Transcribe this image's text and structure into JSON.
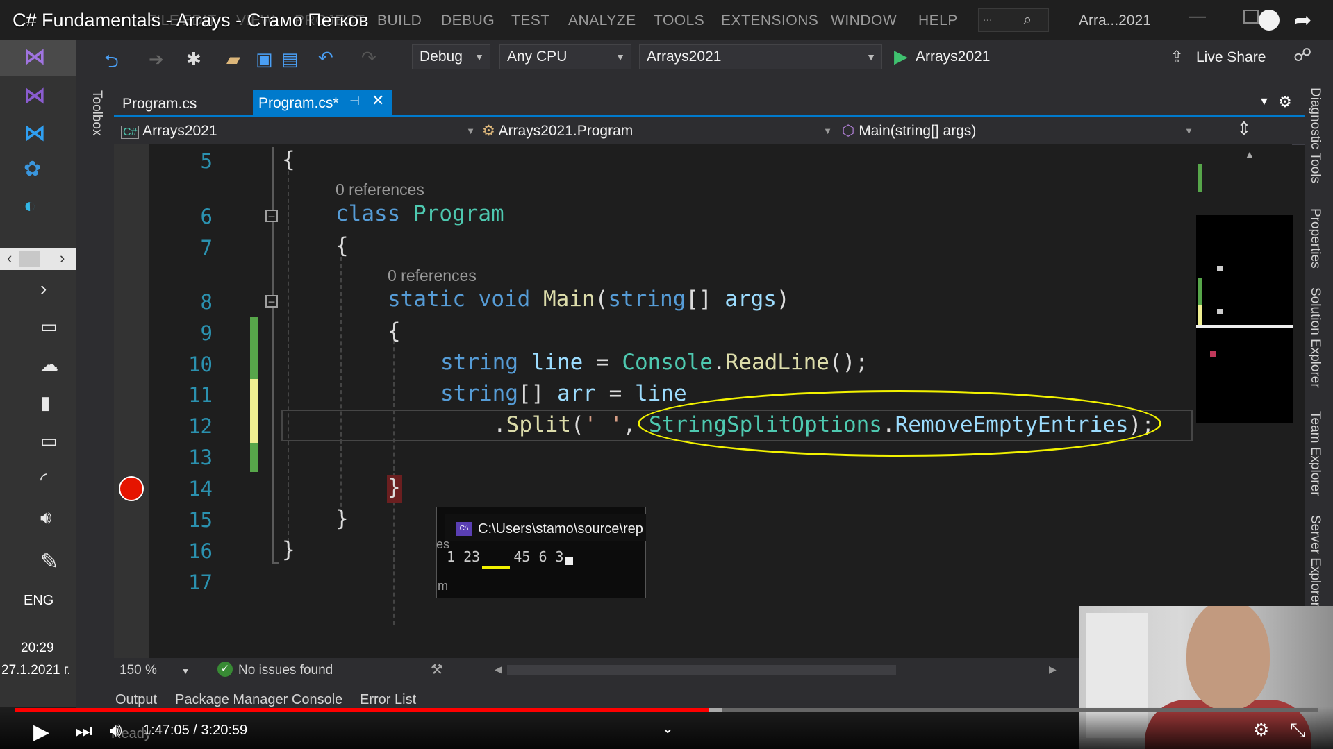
{
  "window": {
    "video_title": "C# Fundamentals - Arrays - Стамо Петков",
    "menus": [
      "FILE",
      "EDIT",
      "VIEW",
      "PROJECT",
      "BUILD",
      "DEBUG",
      "TEST",
      "ANALYZE",
      "TOOLS",
      "EXTENSIONS",
      "WINDOW",
      "HELP"
    ],
    "search_placeholder": "...",
    "solution_name": "Arra...2021"
  },
  "toolbar": {
    "configuration": "Debug",
    "platform": "Any CPU",
    "startup_project": "Arrays2021",
    "run_target": "Arrays2021",
    "live_share": "Live Share"
  },
  "tabs": [
    {
      "label": "Program.cs",
      "active": false
    },
    {
      "label": "Program.cs*",
      "active": true
    }
  ],
  "navigation": {
    "project": "Arrays2021",
    "type": "Arrays2021.Program",
    "member": "Main(string[] args)"
  },
  "editor": {
    "line_numbers": [
      "5",
      "6",
      "7",
      "8",
      "9",
      "10",
      "11",
      "12",
      "13",
      "14",
      "15",
      "16",
      "17"
    ],
    "references_label": "0 references",
    "lines": {
      "l5": "{",
      "l6_kw": "class",
      "l6_type": "Program",
      "l7": "{",
      "l8_static": "static",
      "l8_void": "void",
      "l8_method": "Main",
      "l8_paren": "(",
      "l8_string": "string",
      "l8_brackets": "[] ",
      "l8_args": "args",
      "l8_close": ")",
      "l9": "{",
      "l10_string": "string",
      "l10_var": "line",
      "l10_eq": " = ",
      "l10_console": "Console",
      "l10_dot": ".",
      "l10_method": "ReadLine",
      "l10_end": "();",
      "l11_string": "string",
      "l11_brackets": "[] ",
      "l11_var": "arr",
      "l11_eq": " = ",
      "l11_line": "line",
      "l12_dot": ".",
      "l12_split": "Split",
      "l12_open": "(",
      "l12_char": "' '",
      "l12_comma": ", ",
      "l12_enum": "StringSplitOptions",
      "l12_dot2": ".",
      "l12_member": "RemoveEmptyEntries",
      "l12_end": ");",
      "l14": "}",
      "l15": "}",
      "l16": "}"
    }
  },
  "console": {
    "title": "C:\\Users\\stamo\\source\\rep",
    "output": "1 23    45 6 3",
    "left_clip_1": "es",
    "left_clip_2": "m"
  },
  "status": {
    "zoom": "150 %",
    "issues": "No issues found",
    "ready": "Ready"
  },
  "output_tabs": [
    "Output",
    "Package Manager Console",
    "Error List"
  ],
  "right_dock": [
    "Diagnostic Tools",
    "Properties",
    "Solution Explorer",
    "Team Explorer",
    "Server Explorer"
  ],
  "toolbox_label": "Toolbox",
  "taskbar": {
    "language": "ENG",
    "time": "20:29",
    "date": "27.1.2021 г."
  },
  "player": {
    "time": "1:47:05 / 3:20:59",
    "progress": 0.533
  },
  "colors": {
    "accent": "#007acc",
    "keyword": "#569cd6",
    "type": "#4ec9b0",
    "method": "#dcdcaa",
    "breakpoint": "#e51400",
    "annotation": "#f2f200",
    "progress": "#ff0000"
  }
}
